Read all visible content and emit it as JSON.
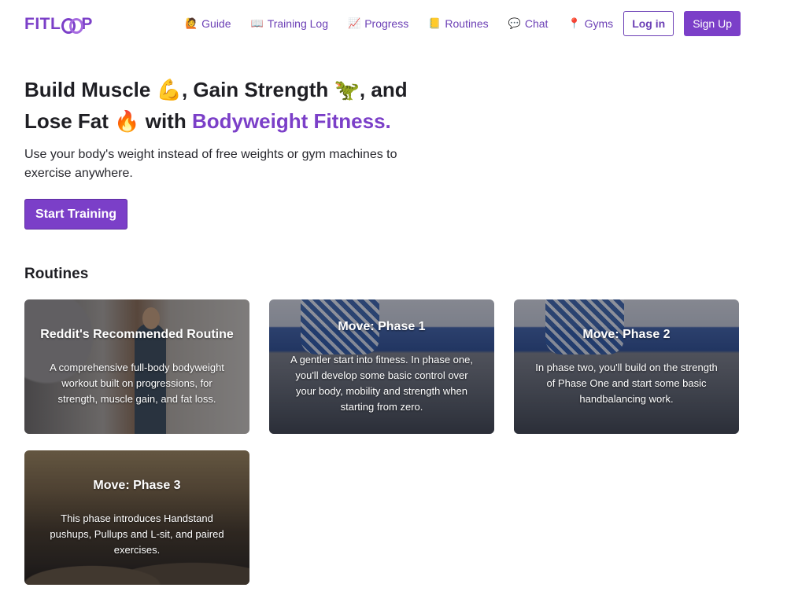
{
  "brand": {
    "logo_text_before": "FITL",
    "logo_text_after": "P"
  },
  "nav": {
    "items": [
      {
        "icon": "🙋",
        "label": "Guide"
      },
      {
        "icon": "📖",
        "label": "Training Log"
      },
      {
        "icon": "📈",
        "label": "Progress"
      },
      {
        "icon": "📒",
        "label": "Routines"
      },
      {
        "icon": "💬",
        "label": "Chat"
      },
      {
        "icon": "📍",
        "label": "Gyms"
      }
    ],
    "login_label": "Log in",
    "signup_label": "Sign Up"
  },
  "hero": {
    "title_line1_a": "Build Muscle ",
    "emoji_muscle": "💪",
    "title_line1_b": ", Gain Strength ",
    "emoji_dino": "🦖",
    "title_line1_c": ", and",
    "title_line2_a": "Lose Fat ",
    "emoji_fire": "🔥",
    "title_line2_b": " with ",
    "title_accent": "Bodyweight Fitness.",
    "subtitle": "Use your body's weight instead of free weights or gym machines to exercise anywhere.",
    "cta_label": "Start Training"
  },
  "routines": {
    "heading": "Routines",
    "cards": [
      {
        "title": "Reddit's Recommended Routine",
        "description": "A comprehensive full-body bodyweight workout built on progressions, for strength, muscle gain, and fat loss."
      },
      {
        "title": "Move: Phase 1",
        "description": "A gentler start into fitness. In phase one, you'll develop some basic control over your body, mobility and strength when starting from zero."
      },
      {
        "title": "Move: Phase 2",
        "description": "In phase two, you'll build on the strength of Phase One and start some basic handbalancing work."
      },
      {
        "title": "Move: Phase 3",
        "description": "This phase introduces Handstand pushups, Pullups and L-sit, and paired exercises."
      }
    ]
  },
  "colors": {
    "brand": "#7b3fc8"
  }
}
